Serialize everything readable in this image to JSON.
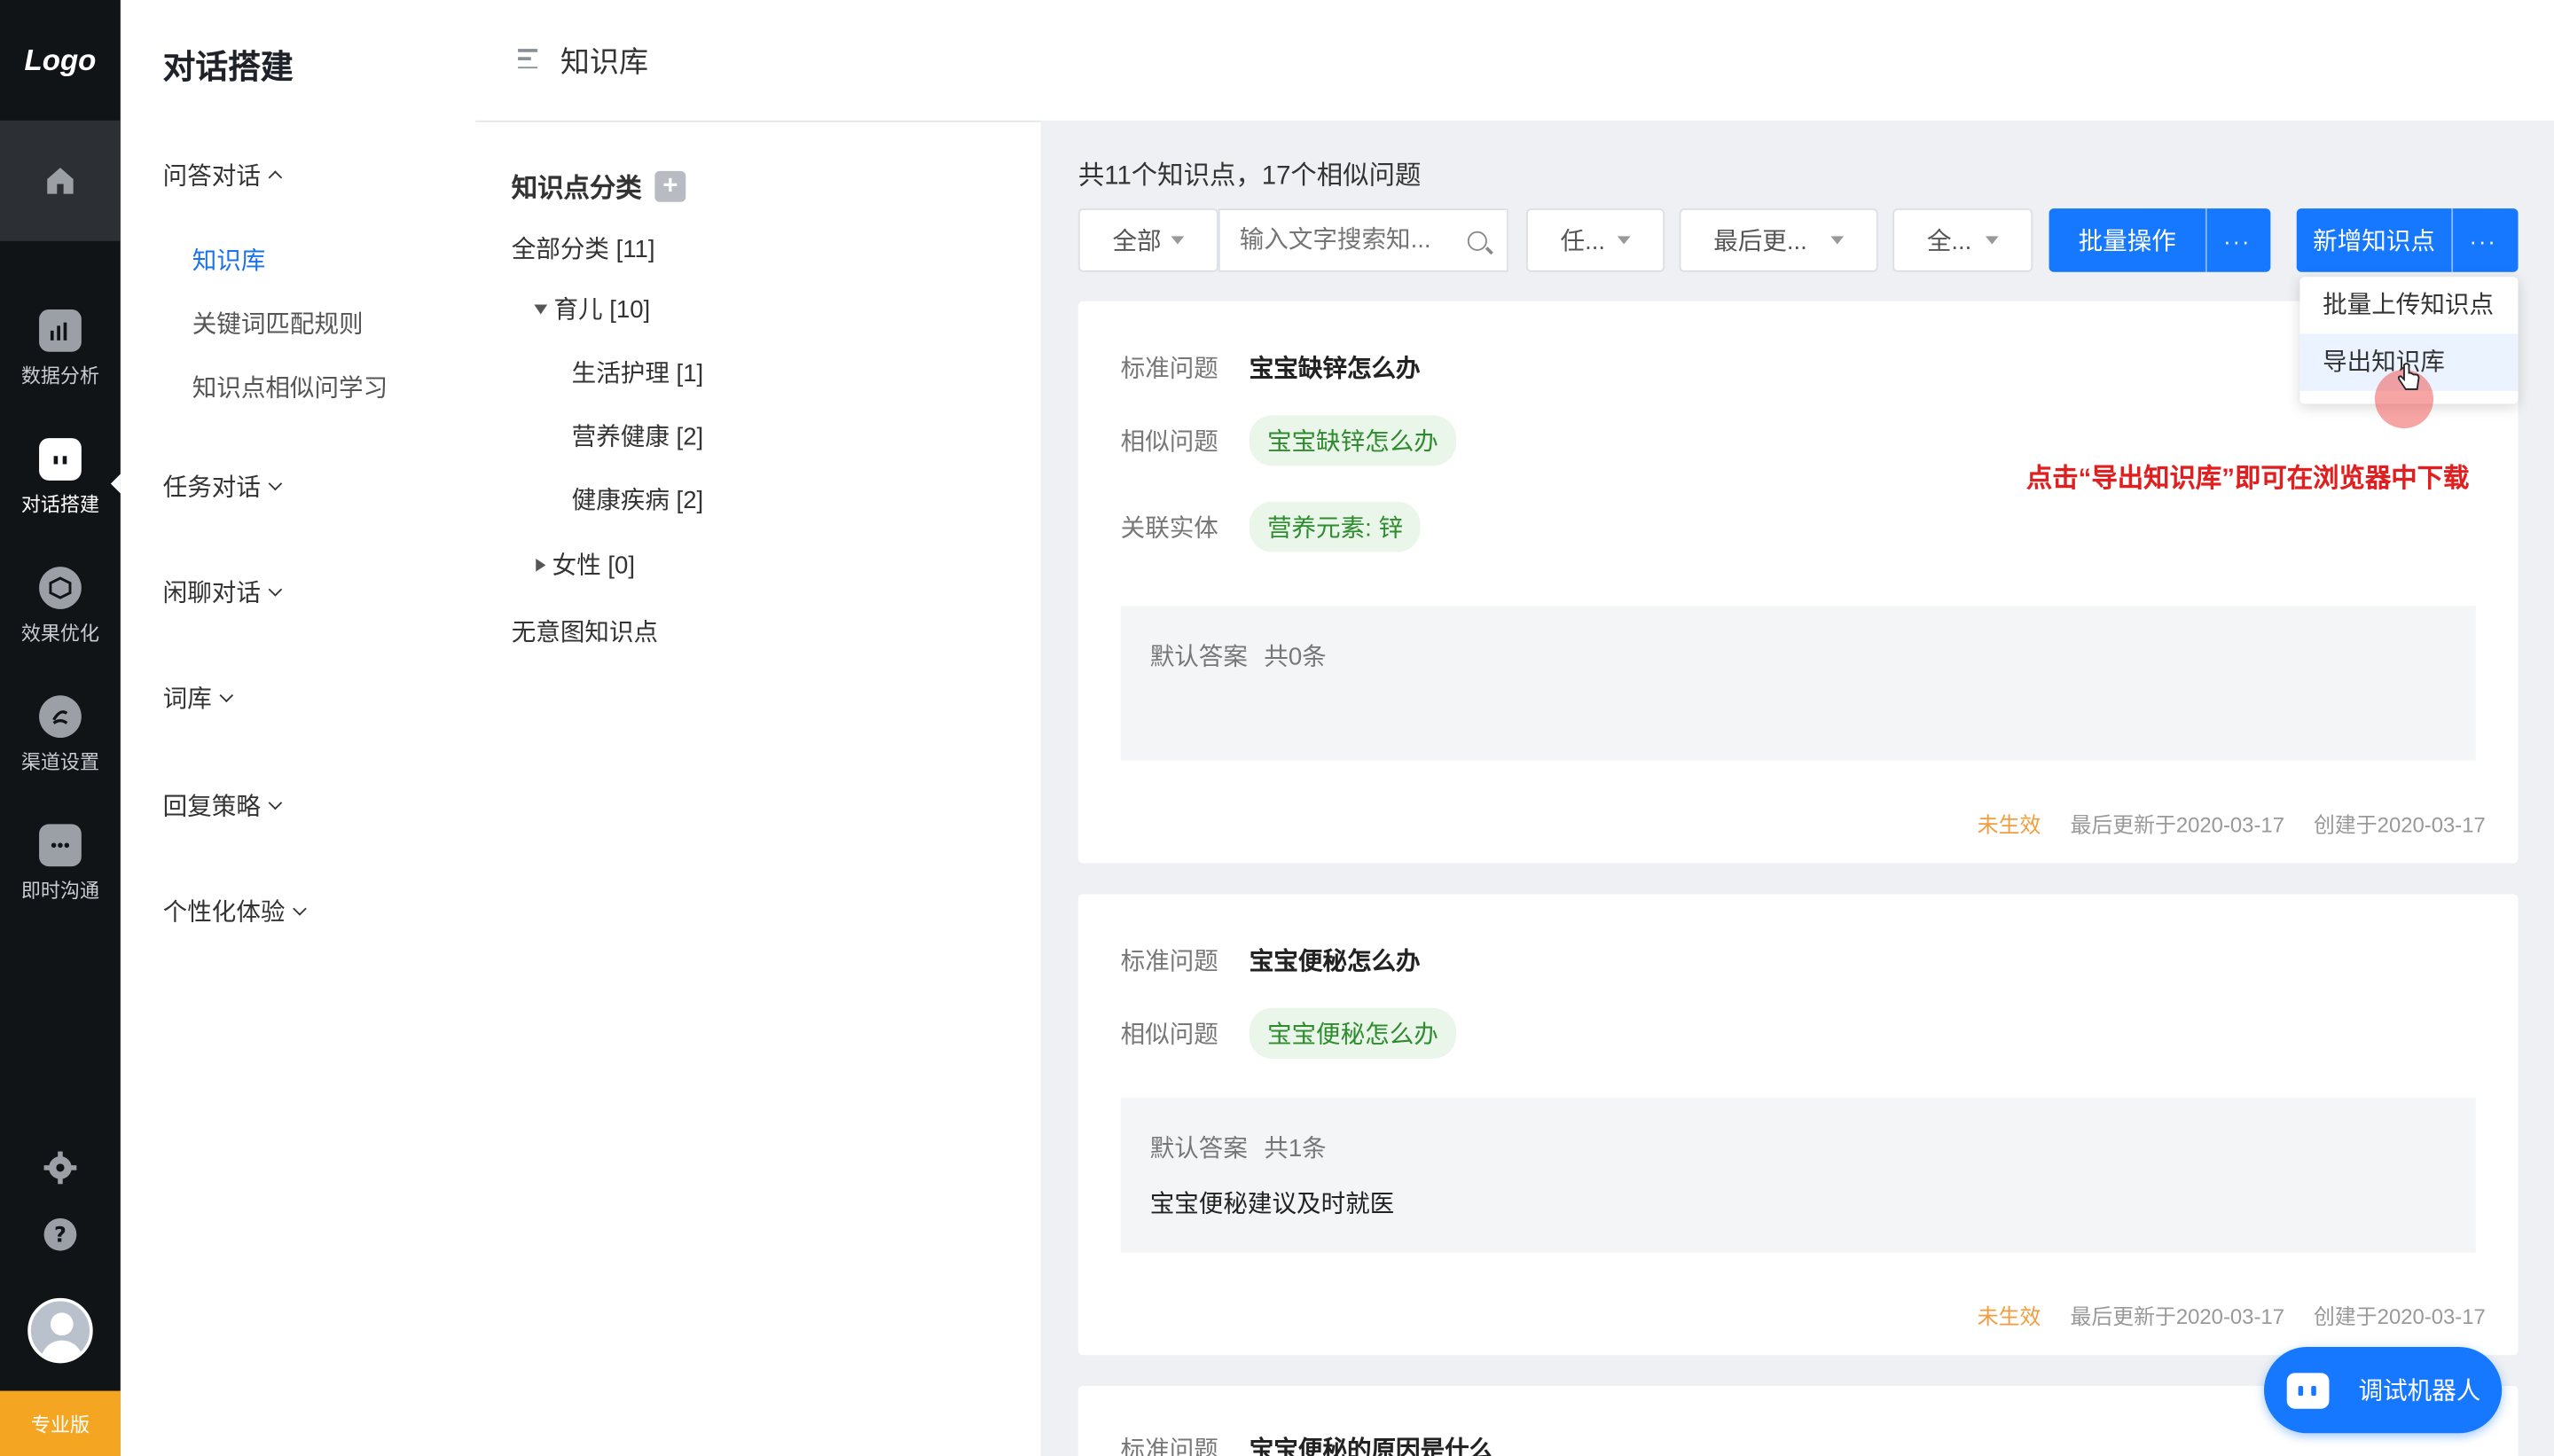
{
  "rail": {
    "logo": "Logo",
    "items": [
      {
        "label": "数据分析",
        "icon": "bar-chart-icon"
      },
      {
        "label": "对话搭建",
        "icon": "robot-icon"
      },
      {
        "label": "效果优化",
        "icon": "cube-icon"
      },
      {
        "label": "渠道设置",
        "icon": "channel-icon"
      },
      {
        "label": "即时沟通",
        "icon": "chat-bubble-icon"
      }
    ],
    "edition": "专业版"
  },
  "menu": {
    "title": "对话搭建",
    "groups": [
      {
        "label": "问答对话",
        "expanded": true,
        "children": [
          "知识库",
          "关键词匹配规则",
          "知识点相似问学习"
        ]
      },
      {
        "label": "任务对话"
      },
      {
        "label": "闲聊对话"
      },
      {
        "label": "词库"
      },
      {
        "label": "回复策略"
      },
      {
        "label": "个性化体验"
      }
    ]
  },
  "header": {
    "title": "知识库"
  },
  "categories": {
    "heading": "知识点分类",
    "nodes": [
      "全部分类 [11]",
      "育儿 [10]",
      "生活护理 [1]",
      "营养健康 [2]",
      "健康疾病 [2]",
      "女性 [0]",
      "无意图知识点"
    ]
  },
  "main": {
    "summary": "共11个知识点，17个相似问题",
    "filters": {
      "scope": "全部",
      "search_placeholder": "输入文字搜索知...",
      "f2": "任...",
      "f3": "最后更...",
      "f4": "全..."
    },
    "buttons": {
      "batch": "批量操作",
      "add": "新增知识点",
      "more": "···"
    },
    "dropdown": [
      "批量上传知识点",
      "导出知识库"
    ],
    "hint": "点击“导出知识库”即可在浏览器中下载",
    "cards": [
      {
        "std_label": "标准问题",
        "std": "宝宝缺锌怎么办",
        "sim_label": "相似问题",
        "sim": "宝宝缺锌怎么办",
        "ent_label": "关联实体",
        "ent": "营养元素: 锌",
        "ans_label": "默认答案",
        "ans_count": "共0条",
        "ans_text": "",
        "status": "未生效",
        "updated": "最后更新于2020-03-17",
        "created": "创建于2020-03-17"
      },
      {
        "std_label": "标准问题",
        "std": "宝宝便秘怎么办",
        "sim_label": "相似问题",
        "sim": "宝宝便秘怎么办",
        "ans_label": "默认答案",
        "ans_count": "共1条",
        "ans_text": "宝宝便秘建议及时就医",
        "status": "未生效",
        "updated": "最后更新于2020-03-17",
        "created": "创建于2020-03-17"
      },
      {
        "std_label": "标准问题",
        "std": "宝宝便秘的原因是什么"
      }
    ],
    "debug_button": "调试机器人"
  },
  "colors": {
    "primary": "#1677ff",
    "rail_bg": "#111417",
    "hint": "#e02020",
    "status": "#f39c3d",
    "tag_bg": "#e9f6e9",
    "tag_fg": "#2e8b2e"
  }
}
